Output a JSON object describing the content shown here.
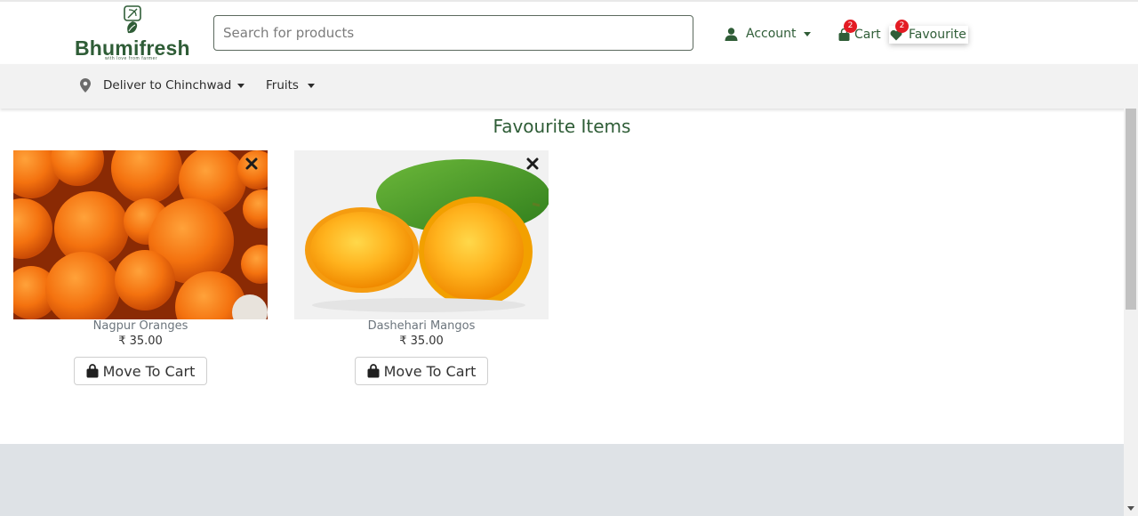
{
  "header": {
    "brand": "Bhumifresh",
    "tagline": "with love from farmer",
    "search_placeholder": "Search for products",
    "account_label": "Account",
    "cart_label": "Cart",
    "cart_count": "2",
    "favourite_label": "Favourite",
    "favourite_count": "2"
  },
  "subnav": {
    "deliver_label": "Deliver to Chinchwad",
    "category_label": "Fruits"
  },
  "main": {
    "title": "Favourite Items",
    "items": [
      {
        "name": "Nagpur Oranges",
        "price": "₹ 35.00",
        "button": "Move To Cart",
        "image": "oranges-image"
      },
      {
        "name": "Dashehari Mangos",
        "price": "₹ 35.00",
        "button": "Move To Cart",
        "image": "mangos-image"
      }
    ]
  },
  "colors": {
    "brand_green": "#2f5d37",
    "badge_red": "#e31b23",
    "subnav_bg": "#f2f2f2",
    "footer_bg": "#dee2e6"
  }
}
